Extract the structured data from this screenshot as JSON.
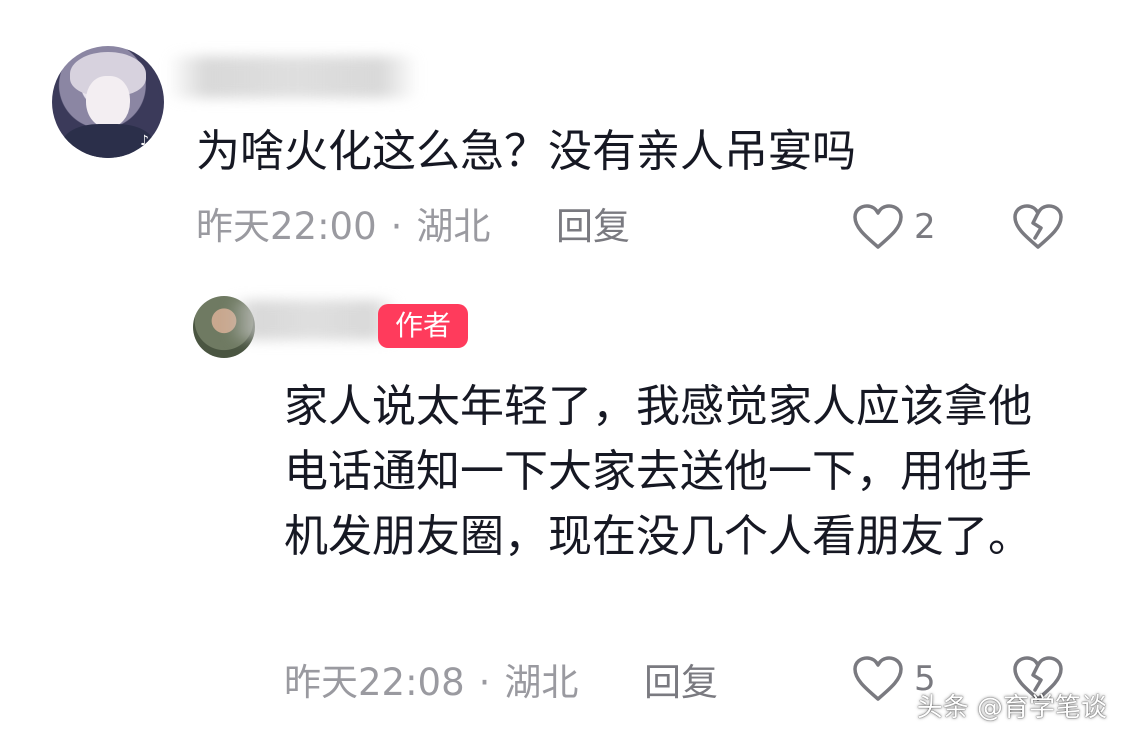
{
  "comments": [
    {
      "text": "为啥火化这么急？没有亲人吊宴吗",
      "time": "昨天22:00",
      "location": "湖北",
      "reply_label": "回复",
      "likes": "2",
      "is_author": false
    },
    {
      "author_badge": "作者",
      "text": "家人说太年轻了，我感觉家人应该拿他电话通知一下大家去送他一下，用他手机发朋友圈，现在没几个人看朋友了。",
      "time": "昨天22:08",
      "location": "湖北",
      "reply_label": "回复",
      "likes": "5",
      "is_author": true
    }
  ],
  "separator": "·",
  "watermark": "头条 @育学笔谈",
  "colors": {
    "text": "#161823",
    "meta": "#9a9aa0",
    "badge_bg": "#ff3b5c",
    "badge_text": "#ffffff",
    "icon": "#7a7a80"
  },
  "icons": {
    "like": "heart-outline-icon",
    "dislike": "broken-heart-icon",
    "platform": "tiktok-icon"
  }
}
